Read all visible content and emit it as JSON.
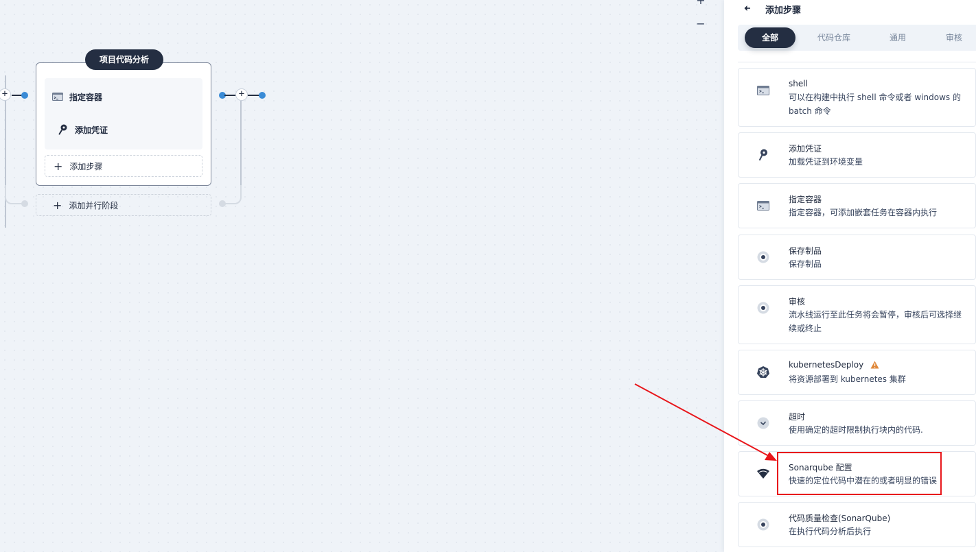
{
  "canvas": {
    "zoom_in_label": "+",
    "zoom_out_label": "−",
    "stage": {
      "title": "项目代码分析",
      "steps": [
        {
          "label": "指定容器",
          "icon": "terminal-icon"
        },
        {
          "label": "添加凭证",
          "icon": "key-icon"
        }
      ],
      "add_step_label": "添加步骤"
    },
    "add_parallel_label": "添加并行阶段",
    "connector_plus": "+"
  },
  "panel": {
    "title": "添加步骤",
    "back_icon": "back-icon",
    "tabs": [
      {
        "label": "全部",
        "active": true
      },
      {
        "label": "代码仓库",
        "active": false
      },
      {
        "label": "通用",
        "active": false
      },
      {
        "label": "审核",
        "active": false
      }
    ],
    "cards": [
      {
        "name": "shell",
        "desc": "可以在构建中执行 shell 命令或者 windows 的 batch 命令",
        "icon": "terminal-icon"
      },
      {
        "name": "添加凭证",
        "desc": "加载凭证到环境变量",
        "icon": "key-icon"
      },
      {
        "name": "指定容器",
        "desc": "指定容器，可添加嵌套任务在容器内执行",
        "icon": "terminal-icon"
      },
      {
        "name": "保存制品",
        "desc": "保存制品",
        "icon": "circle-dot-icon"
      },
      {
        "name": "审核",
        "desc": "流水线运行至此任务将会暂停，审核后可选择继续或终止",
        "icon": "circle-dot-icon"
      },
      {
        "name": "kubernetesDeploy",
        "desc": "将资源部署到 kubernetes 集群",
        "icon": "kubernetes-icon",
        "warning_icon": "warning-icon"
      },
      {
        "name": "超时",
        "desc": "使用确定的超时限制执行块内的代码.",
        "icon": "clock-icon"
      },
      {
        "name": "Sonarqube 配置",
        "desc": "快速的定位代码中潜在的或者明显的错误",
        "icon": "sonarqube-icon"
      },
      {
        "name": "代码质量检查(SonarQube)",
        "desc": "在执行代码分析后执行",
        "icon": "circle-dot-icon"
      }
    ]
  },
  "colors": {
    "primary_dark": "#242e42",
    "accent_blue": "#3a8bd6",
    "highlight_red": "#e8161b",
    "warning": "#f5a623"
  }
}
